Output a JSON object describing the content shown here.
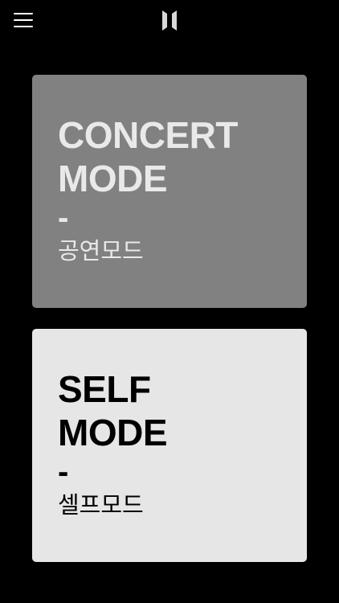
{
  "header": {
    "menu_icon": "hamburger-menu-icon",
    "logo_icon": "bts-logo-icon"
  },
  "cards": [
    {
      "title": "CONCERT\nMODE",
      "dash": "-",
      "subtitle": "공연모드",
      "background": "#818181",
      "text_color": "#e9e9e9"
    },
    {
      "title": "SELF\nMODE",
      "dash": "-",
      "subtitle": "셀프모드",
      "background": "#e6e6e6",
      "text_color": "#000000"
    }
  ]
}
